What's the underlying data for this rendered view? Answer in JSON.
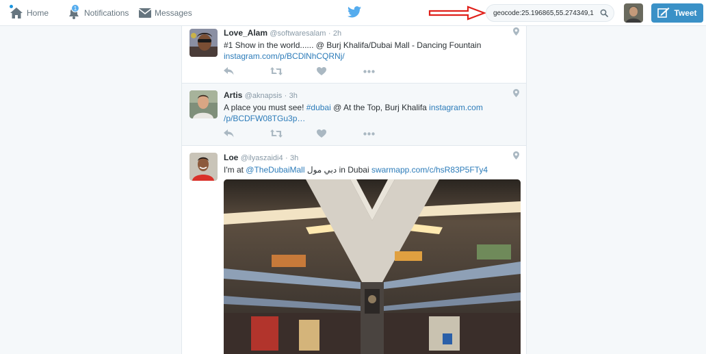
{
  "nav": {
    "home_label": "Home",
    "notifications_label": "Notifications",
    "notifications_count": "1",
    "messages_label": "Messages"
  },
  "search": {
    "value": "geocode:25.196865,55.274349,1"
  },
  "tweet_button_label": "Tweet",
  "colors": {
    "accent": "#55acee",
    "tweet_button": "#3a91c7",
    "link": "#2b7bb9",
    "annotation_arrow": "#e0201a"
  },
  "tweets": [
    {
      "name": "Love_Alam",
      "handle": "@softwaresalam",
      "time": "2h",
      "text_line1": "#1 Show in the world...... @ Burj Khalifa/Dubai Mall - Dancing Fountain",
      "link": "instagram.com/p/BCDlNhCQRNj/"
    },
    {
      "name": "Artis",
      "handle": "@aknapsis",
      "time": "3h",
      "text_plain": "A place you must see! ",
      "hashtag": "#dubai",
      "text_mid": " @ At the Top, Burj Khalifa ",
      "link_part1": "instagram.com",
      "link_part2": "/p/BCDFW08TGu3p…"
    },
    {
      "name": "Loe",
      "handle": "@ilyaszaidi4",
      "time": "3h",
      "text_prefix": "I'm at ",
      "mention": "@TheDubaiMall",
      "arabic": " دبي مول ",
      "text_mid": "in Dubai ",
      "link": "swarmapp.com/c/hsR83P5FTy4"
    }
  ],
  "separator": "·",
  "icons": {
    "home": "home-icon",
    "notifications": "bell-icon",
    "messages": "envelope-icon",
    "logo": "twitter-bird-icon",
    "search": "search-icon",
    "compose": "compose-icon",
    "geo": "location-pin-icon",
    "reply": "reply-icon",
    "retweet": "retweet-icon",
    "like": "heart-icon",
    "more": "more-icon"
  }
}
